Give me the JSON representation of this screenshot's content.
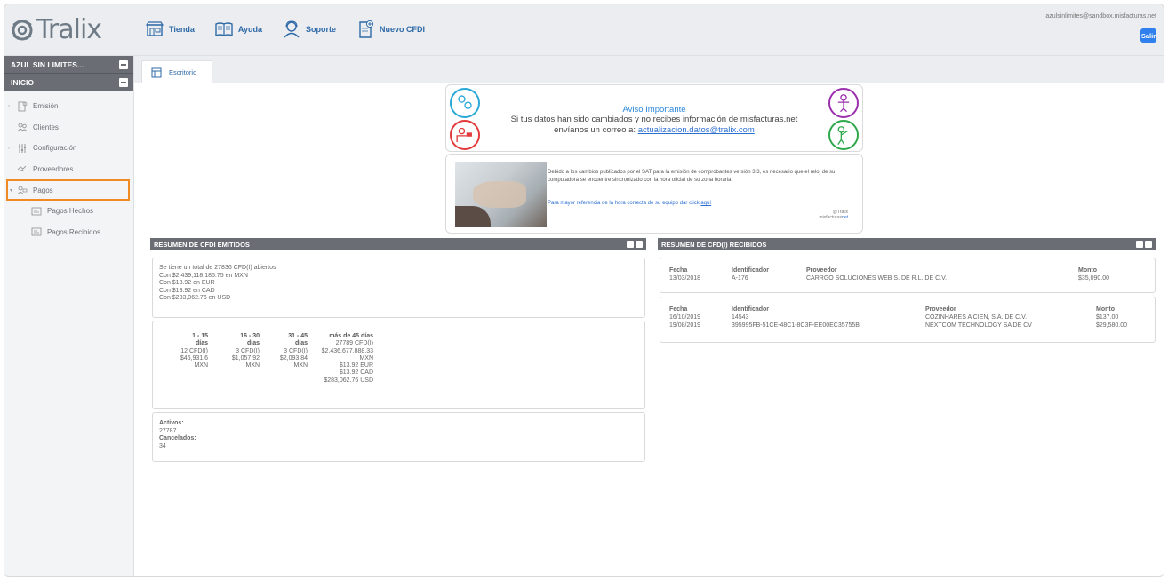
{
  "brand": {
    "logo_text": "Tralix"
  },
  "topnav": [
    {
      "label": "Tienda",
      "icon": "store-icon"
    },
    {
      "label": "Ayuda",
      "icon": "book-icon"
    },
    {
      "label": "Soporte",
      "icon": "support-icon"
    },
    {
      "label": "Nuevo CFDI",
      "icon": "new-document-icon"
    }
  ],
  "user": {
    "email": "azulsinlimites@sandbox.misfacturas.net",
    "logout_label": "Salir"
  },
  "sidebar": {
    "company": "AZUL SIN LIMITES...",
    "section": "INICIO",
    "items": [
      {
        "label": "Emisión"
      },
      {
        "label": "Clientes"
      },
      {
        "label": "Configuración"
      },
      {
        "label": "Proveedores"
      },
      {
        "label": "Pagos"
      },
      {
        "label": "Pagos Hechos"
      },
      {
        "label": "Pagos Recibidos"
      }
    ]
  },
  "tabs": [
    {
      "label": "Escritorio"
    }
  ],
  "aviso": {
    "title": "Aviso Importante",
    "line1": "Si tus datos han sido cambiados y no recibes información de misfacturas.net",
    "line2_prefix": "envíanos un correo a: ",
    "email": "actualizacion.datos@tralix.com"
  },
  "sat_notice": {
    "text": "Debido a los cambios publicados por el SAT para la emisión de comprobantes versión 3.3, es necesario que el reloj de su computadora se encuentre sincronizado con la hora oficial de su zona horaria.",
    "ref_prefix": "Para mayor referencia de la hora correcta de su equipo dar click ",
    "ref_link": "aquí",
    "sig1": "@Tralix",
    "sig2": "misfacturas",
    "sig3": "net"
  },
  "emitidos": {
    "header": "RESUMEN DE CFDI EMITIDOS",
    "summary": [
      "Se tiene un total de 27836 CFD(I) abiertos",
      "Con $2,439,118,185.75 en MXN",
      "Con $13.92 en EUR",
      "Con $13.92 en CAD",
      "Con $283,062.76 en USD"
    ],
    "aging": [
      {
        "h1": "1 - 15",
        "h2": "días",
        "lines": [
          "12 CFD(I)",
          "$46,931.6",
          "MXN"
        ]
      },
      {
        "h1": "16 - 30",
        "h2": "días",
        "lines": [
          "3 CFD(I)",
          "$1,057.92",
          "MXN"
        ]
      },
      {
        "h1": "31 - 45",
        "h2": "días",
        "lines": [
          "3 CFD(I)",
          "$2,093.84",
          "MXN"
        ]
      },
      {
        "h1": "más de 45 días",
        "h2": "",
        "lines": [
          "27789 CFD(I)",
          "$2,436,677,888.33",
          "MXN",
          "$13.92 EUR",
          "$13.92 CAD",
          "$283,062.76 USD"
        ]
      }
    ],
    "activos_label": "Activos:",
    "activos_value": "27787",
    "cancelados_label": "Cancelados:",
    "cancelados_value": "34"
  },
  "recibidos": {
    "header": "RESUMEN DE CFD(I) RECIBIDOS",
    "cols": {
      "fecha": "Fecha",
      "ident": "Identificador",
      "prov": "Proveedor",
      "monto": "Monto"
    },
    "box1": [
      {
        "fecha": "13/03/2018",
        "ident": "A-176",
        "prov": "CARRGO SOLUCIONES WEB S. DE R.L. DE C.V.",
        "monto": "$35,090.00"
      }
    ],
    "box2": [
      {
        "fecha": "16/10/2019",
        "ident": "14543",
        "prov": "COZINHARES A CIEN, S.A. DE C.V.",
        "monto": "$137.00"
      },
      {
        "fecha": "19/08/2019",
        "ident": "395995FB-51CE-48C1-8C3F-EE00EC35755B",
        "prov": "NEXTCOM TECHNOLOGY SA DE CV",
        "monto": "$29,580.00"
      }
    ]
  },
  "colors": {
    "accent": "#2f6aa8",
    "header_dark": "#6a6d74",
    "highlight": "#f08a24"
  }
}
